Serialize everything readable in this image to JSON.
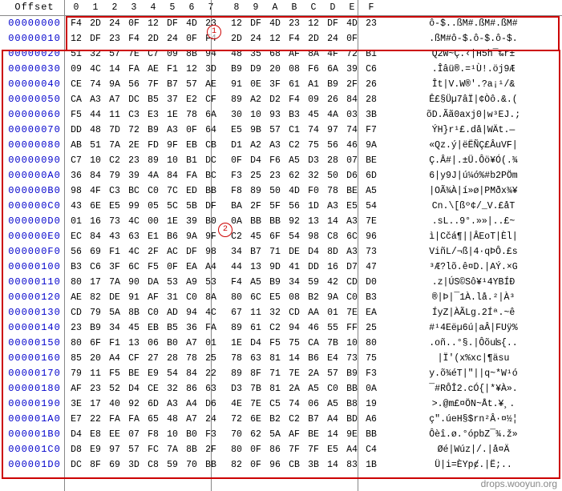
{
  "header": {
    "offset_label": "Offset",
    "cols": [
      "0",
      "1",
      "2",
      "3",
      "4",
      "5",
      "6",
      "7",
      "8",
      "9",
      "A",
      "B",
      "C",
      "D",
      "E",
      "F"
    ]
  },
  "rows": [
    {
      "off": "00000000",
      "hex": [
        "F4",
        "2D",
        "24",
        "0F",
        "12",
        "DF",
        "4D",
        "23",
        "",
        "12",
        "DF",
        "4D",
        "23",
        "12",
        "DF",
        "4D",
        "23"
      ],
      "asc": "ô-$..ßM#.ßM#.ßM#"
    },
    {
      "off": "00000010",
      "hex": [
        "12",
        "DF",
        "23",
        "F4",
        "2D",
        "24",
        "0F",
        "",
        "F4",
        "2D",
        "24",
        "12",
        "F4",
        "2D",
        "24",
        "0F"
      ],
      "asc": ".ßM#ô-$.ô-$.ô-$."
    },
    {
      "off": "00000020",
      "hex": [
        "51",
        "32",
        "57",
        "7E",
        "C7",
        "09",
        "8B",
        "94",
        "48",
        "35",
        "68",
        "AF",
        "8A",
        "4F",
        "72",
        "B1"
      ],
      "asc": "Q2W~Ç.‹|H5h¯‰r±"
    },
    {
      "off": "00000030",
      "hex": [
        "09",
        "4C",
        "14",
        "FA",
        "AE",
        "F1",
        "12",
        "3D",
        "B9",
        "D9",
        "20",
        "08",
        "F6",
        "6A",
        "39",
        "C6"
      ],
      "asc": ".Îâü®.=¹Ù!.öj9Æ"
    },
    {
      "off": "00000040",
      "hex": [
        "CE",
        "74",
        "9A",
        "56",
        "7F",
        "B7",
        "57",
        "AE",
        "91",
        "0E",
        "3F",
        "61",
        "A1",
        "B9",
        "2F",
        "26"
      ],
      "asc": "Ît|V.W®'.?a¡¹/&"
    },
    {
      "off": "00000050",
      "hex": [
        "CA",
        "A3",
        "A7",
        "DC",
        "B5",
        "37",
        "E2",
        "CF",
        "89",
        "A2",
        "D2",
        "F4",
        "09",
        "26",
        "84",
        "28"
      ],
      "asc": "Ê£§Üµ7âÏ|¢Òô.&.("
    },
    {
      "off": "00000060",
      "hex": [
        "F5",
        "44",
        "11",
        "C3",
        "E3",
        "1E",
        "78",
        "6A",
        "30",
        "10",
        "93",
        "B3",
        "45",
        "4A",
        "03",
        "3B"
      ],
      "asc": "õD.Ãã0axj0|w³EJ.;"
    },
    {
      "off": "00000070",
      "hex": [
        "DD",
        "48",
        "7D",
        "72",
        "B9",
        "A3",
        "0F",
        "64",
        "E5",
        "9B",
        "57",
        "C1",
        "74",
        "97",
        "74",
        "F7"
      ],
      "asc": "ÝH}r¹£.då|WÄt.—"
    },
    {
      "off": "00000080",
      "hex": [
        "AB",
        "51",
        "7A",
        "2E",
        "FD",
        "9F",
        "EB",
        "CB",
        "D1",
        "A2",
        "A3",
        "C2",
        "75",
        "56",
        "46",
        "9A"
      ],
      "asc": "«Qz.ý|ëËÑÇ£ÂuVF|"
    },
    {
      "off": "00000090",
      "hex": [
        "C7",
        "10",
        "C2",
        "23",
        "89",
        "10",
        "B1",
        "DC",
        "0F",
        "D4",
        "F6",
        "A5",
        "D3",
        "28",
        "07",
        "BE"
      ],
      "asc": "Ç.Â#|.±Ü.Ôö¥Ó(.¾"
    },
    {
      "off": "000000A0",
      "hex": [
        "36",
        "84",
        "79",
        "39",
        "4A",
        "84",
        "FA",
        "BC",
        "F3",
        "25",
        "23",
        "62",
        "32",
        "50",
        "D6",
        "6D"
      ],
      "asc": "6|y9J|ú¼ó%#b2PÖm"
    },
    {
      "off": "000000B0",
      "hex": [
        "98",
        "4F",
        "C3",
        "BC",
        "C0",
        "7C",
        "ED",
        "BB",
        "F8",
        "89",
        "50",
        "4D",
        "F0",
        "78",
        "BE",
        "A5"
      ],
      "asc": "|OÃ¾À|í»ø|PMðx¾¥"
    },
    {
      "off": "000000C0",
      "hex": [
        "43",
        "6E",
        "E5",
        "99",
        "05",
        "5C",
        "5B",
        "DF",
        "BA",
        "2F",
        "5F",
        "56",
        "1D",
        "A3",
        "E5",
        "54"
      ],
      "asc": "Cn.\\[ßº¢/_V.£åT"
    },
    {
      "off": "000000D0",
      "hex": [
        "01",
        "16",
        "73",
        "4C",
        "00",
        "1E",
        "39",
        "B0",
        "",
        "0A",
        "BB",
        "BB",
        "92",
        "13",
        "14",
        "A3",
        "7E"
      ],
      "asc": ".sL..9°.»»|..£~"
    },
    {
      "off": "000000E0",
      "hex": [
        "EC",
        "84",
        "43",
        "63",
        "E1",
        "B6",
        "9A",
        "9F",
        "C2",
        "45",
        "6F",
        "54",
        "98",
        "C8",
        "6C",
        "96"
      ],
      "asc": "ì|Cčá¶||ÂEoT|Èl|"
    },
    {
      "off": "000000F0",
      "hex": [
        "56",
        "69",
        "F1",
        "4C",
        "2F",
        "AC",
        "DF",
        "98",
        "34",
        "B7",
        "71",
        "DE",
        "D4",
        "8D",
        "A3",
        "73"
      ],
      "asc": "ViñL/¬ß|4·qÞÔ.£s"
    },
    {
      "off": "00000100",
      "hex": [
        "B3",
        "C6",
        "3F",
        "6C",
        "F5",
        "0F",
        "EA",
        "A4",
        "44",
        "13",
        "9D",
        "41",
        "DD",
        "16",
        "D7",
        "47"
      ],
      "asc": "³Æ?lõ.ê¤D.|AÝ.×G"
    },
    {
      "off": "00000110",
      "hex": [
        "80",
        "17",
        "7A",
        "90",
        "DA",
        "53",
        "A9",
        "53",
        "F4",
        "A5",
        "B9",
        "34",
        "59",
        "42",
        "CD",
        "D0"
      ],
      "asc": ".z|ÚS©Sô¥¹4YBÍÐ"
    },
    {
      "off": "00000120",
      "hex": [
        "AE",
        "82",
        "DE",
        "91",
        "AF",
        "31",
        "C0",
        "8A",
        "80",
        "6C",
        "E5",
        "08",
        "B2",
        "9A",
        "C0",
        "B3"
      ],
      "asc": "®|Þ|¯1À.lå.²|À³"
    },
    {
      "off": "00000130",
      "hex": [
        "CD",
        "79",
        "5A",
        "8B",
        "C0",
        "AD",
        "94",
        "4C",
        "67",
        "11",
        "32",
        "CD",
        "AA",
        "01",
        "7E",
        "EA"
      ],
      "asc": "ÍyZ|À­ÃLg.2Íª.~ê"
    },
    {
      "off": "00000140",
      "hex": [
        "23",
        "B9",
        "34",
        "45",
        "EB",
        "B5",
        "36",
        "FA",
        "89",
        "61",
        "C2",
        "94",
        "46",
        "55",
        "FF",
        "25"
      ],
      "asc": "#¹4Eëµ6ú|aÂ|FUÿ%"
    },
    {
      "off": "00000150",
      "hex": [
        "80",
        "6F",
        "F1",
        "13",
        "06",
        "B0",
        "A7",
        "01",
        "1E",
        "D4",
        "F5",
        "75",
        "CA",
        "7B",
        "10",
        "80"
      ],
      "asc": ".oñ..°§.|Ôõuʪ{.."
    },
    {
      "off": "00000160",
      "hex": [
        "85",
        "20",
        "A4",
        "CF",
        "27",
        "28",
        "78",
        "25",
        "78",
        "63",
        "81",
        "14",
        "B6",
        "E4",
        "73",
        "75"
      ],
      "asc": "|Ï'(x%xc|¶äsu"
    },
    {
      "off": "00000170",
      "hex": [
        "79",
        "11",
        "F5",
        "BE",
        "E9",
        "54",
        "84",
        "22",
        "89",
        "8F",
        "71",
        "7E",
        "2A",
        "57",
        "B9",
        "F3"
      ],
      "asc": "y.õ¾éT|\"||q~*W¹ó"
    },
    {
      "off": "00000180",
      "hex": [
        "AF",
        "23",
        "52",
        "D4",
        "CE",
        "32",
        "86",
        "63",
        "D3",
        "7B",
        "81",
        "2A",
        "A5",
        "C0",
        "BB",
        "0A"
      ],
      "asc": "¯#RÔÎ2.cÓ{|*¥À»."
    },
    {
      "off": "00000190",
      "hex": [
        "3E",
        "17",
        "40",
        "92",
        "6D",
        "A3",
        "A4",
        "D6",
        "4E",
        "7E",
        "C5",
        "74",
        "06",
        "A5",
        "B8",
        "19"
      ],
      "asc": ">.@m£¤ÖN~Åt.¥¸."
    },
    {
      "off": "000001A0",
      "hex": [
        "E7",
        "22",
        "FA",
        "FA",
        "65",
        "48",
        "A7",
        "24",
        "72",
        "6E",
        "B2",
        "C2",
        "B7",
        "A4",
        "BD",
        "A6"
      ],
      "asc": "ç\".úeH§$rn²Â·¤½¦"
    },
    {
      "off": "000001B0",
      "hex": [
        "D4",
        "E8",
        "EE",
        "07",
        "F8",
        "10",
        "B0",
        "F3",
        "70",
        "62",
        "5A",
        "AF",
        "BE",
        "14",
        "9E",
        "BB"
      ],
      "asc": "Ôèî.ø.°ópbZ¯¾.ž»"
    },
    {
      "off": "000001C0",
      "hex": [
        "D8",
        "E9",
        "97",
        "57",
        "FC",
        "7A",
        "8B",
        "2F",
        "80",
        "0F",
        "86",
        "7F",
        "7F",
        "E5",
        "A4",
        "C4"
      ],
      "asc": "Øé|Wúz|/.|å¤Ä"
    },
    {
      "off": "000001D0",
      "hex": [
        "DC",
        "8F",
        "69",
        "3D",
        "C8",
        "59",
        "70",
        "BB",
        "82",
        "0F",
        "96",
        "CB",
        "3B",
        "14",
        "83",
        "1B"
      ],
      "asc": "Ü|i=ÈYpȼ.|Ë;.."
    }
  ],
  "annotations": {
    "circle1": "1",
    "circle2": "2"
  },
  "watermark": "drops.wooyun.org"
}
